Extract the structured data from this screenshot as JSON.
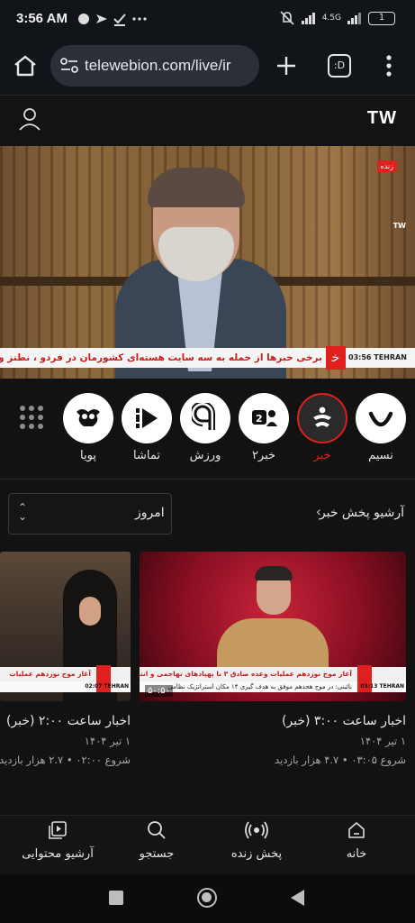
{
  "status_bar": {
    "time": "3:56 AM",
    "network": "4.5G",
    "battery": "1"
  },
  "browser": {
    "url": "telewebion.com/live/ir",
    "tab_count": ":D"
  },
  "site": {
    "logo": "TW"
  },
  "player": {
    "live_badge": "زنده",
    "ticker_text": "برخی خبرها از حمله به سه سایت هسته‌ای کشورمان در فردو ، نطنز و اصفهان حکایت دارد",
    "ticker_time": "03:56 TEHRAN",
    "watermark": "TW"
  },
  "channels": [
    {
      "label": "نسیم",
      "icon": "smile-icon",
      "active": false
    },
    {
      "label": "خبر",
      "icon": "khabar-icon",
      "active": true
    },
    {
      "label": "خبر۲",
      "icon": "khabar2-icon",
      "active": false
    },
    {
      "label": "ورزش",
      "icon": "varzesh-icon",
      "active": false
    },
    {
      "label": "تماشا",
      "icon": "tamasha-icon",
      "active": false
    },
    {
      "label": "پویا",
      "icon": "pooya-icon",
      "active": false
    }
  ],
  "archive": {
    "title": "آرشیو پخش خبر",
    "date_select": "امروز"
  },
  "cards": [
    {
      "title": "اخبار ساعت ۳:۰۰ (خبر)",
      "date": "۱ تیر ۱۴۰۴",
      "meta": "شروع ۰۳:۰۵ • ۴.۷ هزار بازدید",
      "duration": "۵۰:۵۰",
      "lower_headline": "آغاز موج نوزدهم عملیات وعده صادق ۳ با پهپادهای تهاجمی و انتحاری",
      "lower_sub": "نائینی: در موج هجدهم موفق به هدف گیری ۱۴ مکان استراتژیک نظامی",
      "lower_time": "03:13 TEHRAN"
    },
    {
      "title": "اخبار ساعت ۲:۰۰ (خبر)",
      "date": "۱ تیر ۱۴۰۴",
      "meta": "شروع ۰۲:۰۰ • ۲.۷ هزار بازدید",
      "lower_headline": "آغاز موج نوزدهم عملیات",
      "lower_time": "02:07 TEHRAN"
    }
  ],
  "bottom_nav": [
    {
      "label": "خانه",
      "icon": "home-icon"
    },
    {
      "label": "پخش زنده",
      "icon": "live-broadcast-icon"
    },
    {
      "label": "جستجو",
      "icon": "search-icon"
    },
    {
      "label": "آرشیو محتوایی",
      "icon": "archive-icon"
    }
  ],
  "colors": {
    "accent": "#e0201c",
    "background": "#121212",
    "url_box": "#2b2f38"
  }
}
